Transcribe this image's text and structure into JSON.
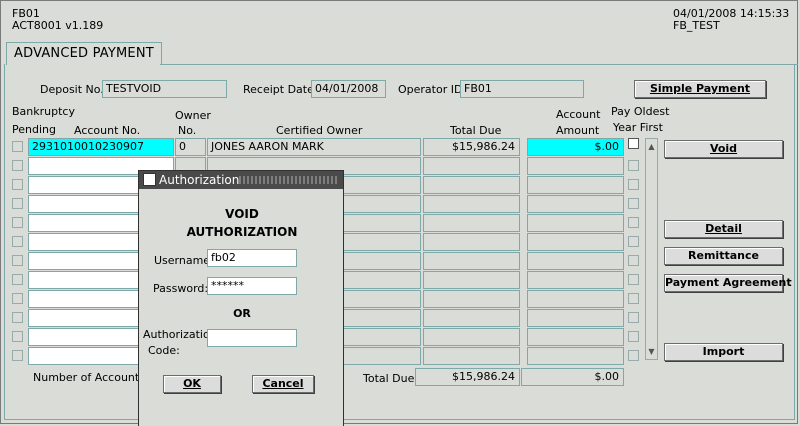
{
  "header": {
    "form_id": "FB01",
    "version": "ACT8001 v1.189",
    "datetime": "04/01/2008 14:15:33",
    "db": "FB_TEST"
  },
  "tab": {
    "label": "ADVANCED PAYMENT"
  },
  "top_fields": {
    "deposit_label": "Deposit No.",
    "deposit_value": "TESTVOID",
    "receipt_date_label": "Receipt Date",
    "receipt_date_value": "04/01/2008",
    "operator_label": "Operator ID",
    "operator_value": "FB01",
    "simple_payment_button": "Simple Payment"
  },
  "columns": {
    "bankruptcy_1": "Bankruptcy",
    "bankruptcy_2": "Pending",
    "account_no": "Account No.",
    "owner_1": "Owner",
    "owner_2": "No.",
    "certified_owner": "Certified Owner",
    "total_due": "Total Due",
    "account_amount_1": "Account",
    "account_amount_2": "Amount",
    "pay_oldest_1": "Pay Oldest",
    "pay_oldest_2": "Year First"
  },
  "rows": [
    {
      "account_no": "2931010010230907",
      "owner_no": "0",
      "certified_owner": "JONES AARON MARK",
      "total_due": "$15,986.24",
      "amount": "$.00"
    }
  ],
  "side_buttons": {
    "void": "Void",
    "detail": "Detail",
    "remittance": "Remittance",
    "payment_agreement": "Payment Agreement",
    "import": "Import"
  },
  "footer": {
    "number_of_accounts_label": "Number of Accounts",
    "total_due_label": "Total Due",
    "total_due_value": "$15,986.24",
    "total_amount_value": "$.00"
  },
  "dialog": {
    "title": "Authorization",
    "heading_1": "VOID",
    "heading_2": "AUTHORIZATION",
    "username_label": "Username:",
    "username_value": "fb02",
    "password_label": "Password:",
    "password_value": "******",
    "or_text": "OR",
    "auth_code_label_1": "Authorization",
    "auth_code_label_2": "Code:",
    "auth_code_value": "",
    "ok_button": "OK",
    "cancel_button": "Cancel"
  },
  "colors": {
    "background": "#d9dcd7",
    "selected_field": "#00ffff",
    "border": "#7fa9a9",
    "title_bar": "#4a4a4a"
  }
}
